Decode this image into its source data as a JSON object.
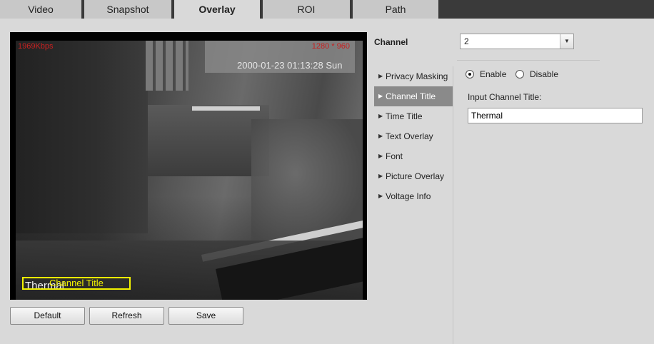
{
  "tabs": [
    {
      "label": "Video",
      "active": false
    },
    {
      "label": "Snapshot",
      "active": false
    },
    {
      "label": "Overlay",
      "active": true
    },
    {
      "label": "ROI",
      "active": false
    },
    {
      "label": "Path",
      "active": false
    }
  ],
  "preview": {
    "bitrate": "1969Kbps",
    "resolution": "1280 * 960",
    "timestamp": "2000-01-23 01:13:28 Sun",
    "channel_name_overlay": "Thermal",
    "channel_title_label": "Channel Title"
  },
  "buttons": {
    "default": "Default",
    "refresh": "Refresh",
    "save": "Save"
  },
  "channel": {
    "label": "Channel",
    "value": "2"
  },
  "menu": {
    "items": [
      {
        "label": "Privacy Masking",
        "active": false
      },
      {
        "label": "Channel Title",
        "active": true
      },
      {
        "label": "Time Title",
        "active": false
      },
      {
        "label": "Text Overlay",
        "active": false
      },
      {
        "label": "Font",
        "active": false
      },
      {
        "label": "Picture Overlay",
        "active": false
      },
      {
        "label": "Voltage Info",
        "active": false
      }
    ]
  },
  "panel": {
    "enable_label": "Enable",
    "disable_label": "Disable",
    "enabled": true,
    "input_label": "Input Channel Title:",
    "input_value": "Thermal"
  }
}
